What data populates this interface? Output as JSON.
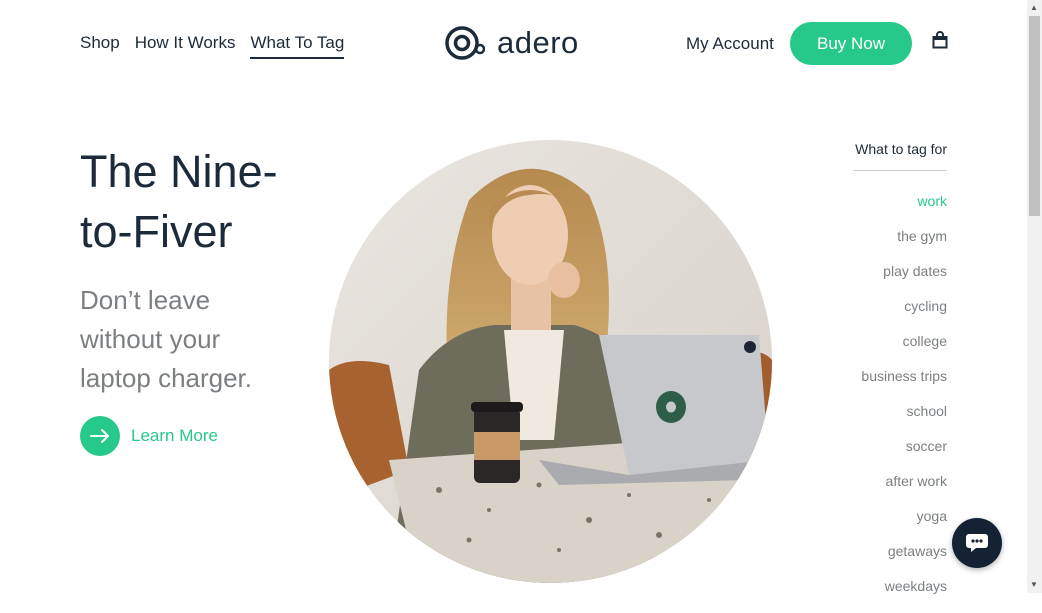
{
  "nav": {
    "items": [
      {
        "label": "Shop"
      },
      {
        "label": "How It Works"
      },
      {
        "label": "What To Tag"
      }
    ],
    "active_item": "What To Tag"
  },
  "brand": {
    "name": "adero"
  },
  "header": {
    "account_label": "My Account",
    "buy_label": "Buy Now"
  },
  "hero": {
    "title": "The Nine-to-Fiver",
    "subtitle": "Don’t leave without your laptop charger.",
    "cta_label": "Learn More"
  },
  "tags": {
    "heading": "What to tag for",
    "items": [
      "work",
      "the gym",
      "play dates",
      "cycling",
      "college",
      "business trips",
      "school",
      "soccer",
      "after work",
      "yoga",
      "getaways",
      "weekdays"
    ],
    "active": "work"
  },
  "colors": {
    "accent": "#27c98a",
    "navy": "#1c2a3a",
    "muted": "#7b7f82"
  },
  "icons": {
    "cart": "shopping-bag-icon",
    "cta": "arrow-right-icon",
    "chat": "chat-bubble-icon",
    "logo": "adero-logo-icon"
  }
}
